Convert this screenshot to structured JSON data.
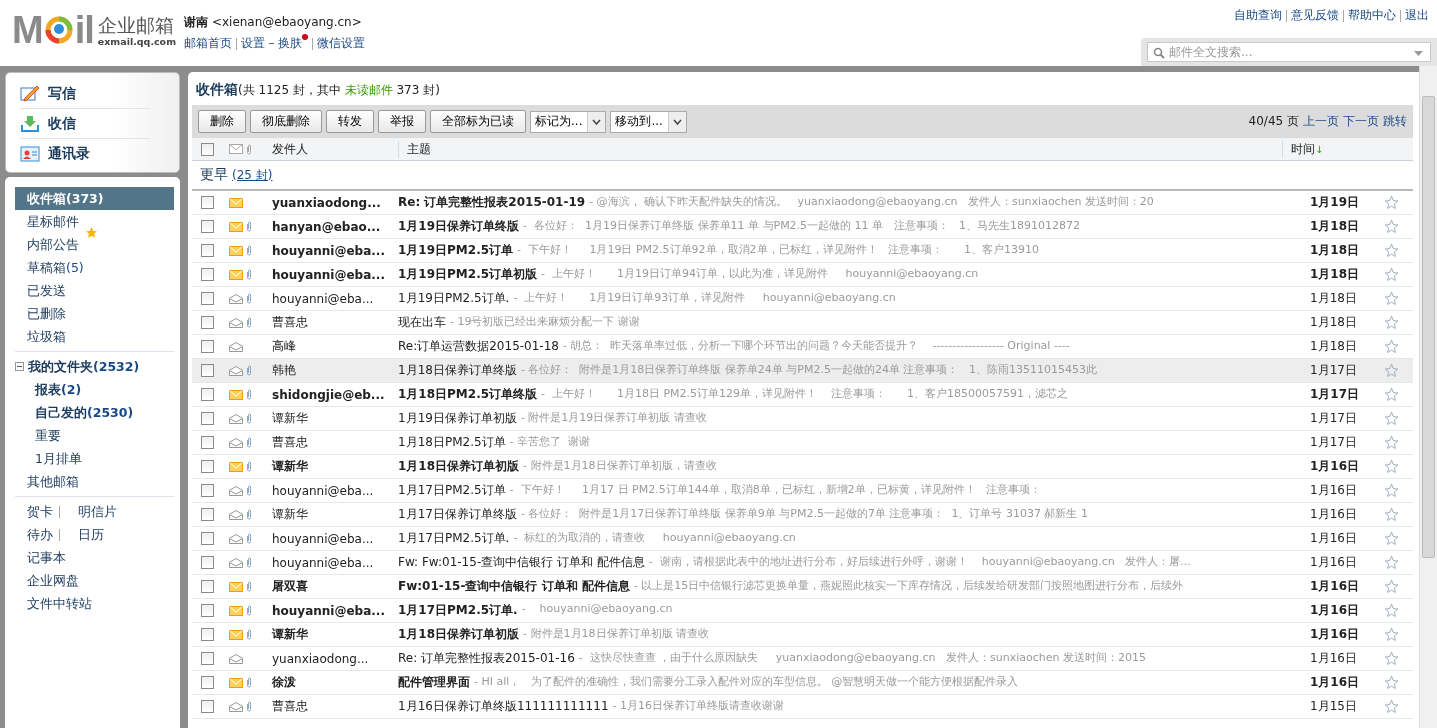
{
  "logo": {
    "prefix": "M",
    "suffix": "il",
    "name": "企业邮箱",
    "domain": "exmail.qq.com"
  },
  "user": {
    "name": "谢南",
    "email": "<xienan@ebaoyang.cn>"
  },
  "nav_links": [
    {
      "label": "邮箱首页",
      "badge": false
    },
    {
      "label": "设置",
      "badge": false
    },
    {
      "label": "换肤",
      "badge": true
    },
    {
      "label": "微信设置",
      "badge": false
    }
  ],
  "top_links": [
    "自助查询",
    "意见反馈",
    "帮助中心",
    "退出"
  ],
  "search": {
    "placeholder": "邮件全文搜索..."
  },
  "actions": [
    {
      "label": "写信",
      "kind": "compose"
    },
    {
      "label": "收信",
      "kind": "receive"
    },
    {
      "label": "通讯录",
      "kind": "contacts"
    }
  ],
  "folders": [
    {
      "label": "收件箱",
      "count": "(373)",
      "selected": true,
      "starred": false
    },
    {
      "label": "星标邮件",
      "selected": false,
      "starred": true
    },
    {
      "label": "内部公告",
      "selected": false,
      "starred": false
    },
    {
      "label": "草稿箱",
      "count": "(5)",
      "selected": false,
      "starred": false
    },
    {
      "label": "已发送",
      "selected": false,
      "starred": false
    },
    {
      "label": "已删除",
      "selected": false,
      "starred": false
    },
    {
      "label": "垃圾箱",
      "selected": false,
      "starred": false
    }
  ],
  "my_folders": {
    "label": "我的文件夹",
    "count": "(2532)",
    "expanded": true,
    "children": [
      {
        "label": "报表",
        "count": "(2)",
        "bold": true
      },
      {
        "label": "自己发的",
        "count": "(2530)",
        "bold": true
      },
      {
        "label": "重要",
        "bold": false
      },
      {
        "label": "1月排单",
        "bold": false
      }
    ]
  },
  "other_mail": "其他邮箱",
  "tools": [
    [
      "贺卡",
      "明信片"
    ],
    [
      "待办",
      "日历"
    ],
    [
      "记事本"
    ],
    [
      "企业网盘"
    ],
    [
      "文件中转站"
    ]
  ],
  "inbox": {
    "title": "收件箱",
    "summary_prefix": "(共 1125 封，其中 ",
    "unread_label": "未读邮件",
    "summary_suffix": " 373 封)"
  },
  "toolbar": {
    "buttons": [
      "删除",
      "彻底删除",
      "转发",
      "举报",
      "全部标为已读"
    ],
    "dropdowns": [
      "标记为...",
      "移动到..."
    ],
    "page": "40/45 页",
    "page_links": [
      "上一页",
      "下一页",
      "跳转"
    ]
  },
  "columns": {
    "select_all_checked": false,
    "sender": "发件人",
    "subject": "主题",
    "time": "时间",
    "sort_arrow": "↓"
  },
  "group": {
    "label": "更早",
    "count": "(25 封)"
  },
  "emails": [
    {
      "sender": "yuanxiaodong...",
      "subject": "Re: 订单完整性报表2015-01-19",
      "preview": "- @海滨， 确认下昨天配件缺失的情况。   yuanxiaodong@ebaoyang.cn   发件人：sunxiaochen 发送时间：20",
      "date": "1月19日",
      "unread": true,
      "attachment": false,
      "selected": false,
      "checked": false
    },
    {
      "sender": "hanyan@ebao...",
      "subject": "1月19日保养订单终版",
      "preview": "-  各位好：  1月19日保养订单终版 保养单11 单 与PM2.5一起做的 11 单   注意事项：   1、马先生1891012872",
      "date": "1月18日",
      "unread": true,
      "attachment": true,
      "selected": false,
      "checked": false
    },
    {
      "sender": "houyanni@eba...",
      "subject": "1月19日PM2.5订单",
      "preview": "-  下午好！     1月19日 PM2.5订单92单，取消2单，已标红，详见附件！   注意事项：      1、客户13910",
      "date": "1月18日",
      "unread": true,
      "attachment": true,
      "selected": false,
      "checked": false
    },
    {
      "sender": "houyanni@eba...",
      "subject": "1月19日PM2.5订单初版",
      "preview": "-  上午好！      1月19日订单94订单，以此为准，详见附件     houyanni@ebaoyang.cn",
      "date": "1月18日",
      "unread": true,
      "attachment": true,
      "selected": false,
      "checked": false
    },
    {
      "sender": "houyanni@eba...",
      "subject": "1月19日PM2.5订单.",
      "preview": "-  上午好！      1月19日订单93订单，详见附件     houyanni@ebaoyang.cn",
      "date": "1月18日",
      "unread": false,
      "attachment": true,
      "selected": false,
      "checked": false
    },
    {
      "sender": "曹喜忠",
      "subject": "现在出车",
      "preview": "- 19号初版已经出来麻烦分配一下 谢谢",
      "date": "1月18日",
      "unread": false,
      "attachment": true,
      "selected": false,
      "checked": false
    },
    {
      "sender": "高峰",
      "subject": "Re:订单运营数据2015-01-18",
      "preview": "- 胡总：  昨天落单率过低，分析一下哪个环节出的问题？今天能否提升？    ------------------ Original ----",
      "date": "1月18日",
      "unread": false,
      "attachment": false,
      "selected": false,
      "checked": false
    },
    {
      "sender": "韩艳",
      "subject": "1月18日保养订单终版",
      "preview": "- 各位好：  附件是1月18日保养订单终版 保养单24单 与PM2.5一起做的24单 注意事项：   1、陈雨13511015453此",
      "date": "1月17日",
      "unread": false,
      "attachment": true,
      "selected": true,
      "checked": false
    },
    {
      "sender": "shidongjie@eb...",
      "subject": "1月18日PM2.5订单终版",
      "preview": "-  上午好！      1月18日 PM2.5订单129单，详见附件！    注意事项：      1、客户18500057591，滤芯之",
      "date": "1月17日",
      "unread": true,
      "attachment": true,
      "selected": false,
      "checked": false
    },
    {
      "sender": "谭新华",
      "subject": "1月19日保养订单初版",
      "preview": "- 附件是1月19日保养订单初版 请查收",
      "date": "1月17日",
      "unread": false,
      "attachment": true,
      "selected": false,
      "checked": false
    },
    {
      "sender": "曹喜忠",
      "subject": "1月18日PM2.5订单",
      "preview": "- 辛苦您了  谢谢",
      "date": "1月17日",
      "unread": false,
      "attachment": true,
      "selected": false,
      "checked": false
    },
    {
      "sender": "谭新华",
      "subject": "1月18日保养订单初版",
      "preview": "- 附件是1月18日保养订单初版，请查收",
      "date": "1月16日",
      "unread": true,
      "attachment": true,
      "selected": false,
      "checked": false
    },
    {
      "sender": "houyanni@eba...",
      "subject": "1月17日PM2.5订单",
      "preview": "-  下午好！     1月17 日 PM2.5订单144单，取消8单，已标红，新增2单，已标黄，详见附件！   注意事项：",
      "date": "1月16日",
      "unread": false,
      "attachment": true,
      "selected": false,
      "checked": false
    },
    {
      "sender": "谭新华",
      "subject": "1月17日保养订单终版",
      "preview": "- 各位好：  附件是1月17日保养订单终版 保养单9单 与PM2.5一起做的7单 注意事项：  1、订单号 31037 郝新生 1",
      "date": "1月16日",
      "unread": false,
      "attachment": true,
      "selected": false,
      "checked": false
    },
    {
      "sender": "houyanni@eba...",
      "subject": "1月17日PM2.5订单.",
      "preview": "-  标红的为取消的，请查收     houyanni@ebaoyang.cn",
      "date": "1月16日",
      "unread": false,
      "attachment": true,
      "selected": false,
      "checked": false
    },
    {
      "sender": "houyanni@eba...",
      "subject": "Fw: Fw:01-15-查询中信银行  订单和 配件信息",
      "preview": "-  谢南，请根据此表中的地址进行分布，好后续进行外呼，谢谢！    houyanni@ebaoyang.cn   发件人：屠...",
      "date": "1月16日",
      "unread": false,
      "attachment": true,
      "selected": false,
      "checked": false
    },
    {
      "sender": "屠双喜",
      "subject": "Fw:01-15-查询中信银行  订单和 配件信息",
      "preview": "- 以上是15日中信银行滤芯更换单量，燕妮照此核实一下库存情况，后续发给研发部门按照地图进行分布，后续外",
      "date": "1月16日",
      "unread": true,
      "attachment": true,
      "selected": false,
      "checked": false
    },
    {
      "sender": "houyanni@eba...",
      "subject": "1月17日PM2.5订单.",
      "preview": "-    houyanni@ebaoyang.cn",
      "date": "1月16日",
      "unread": true,
      "attachment": true,
      "selected": false,
      "checked": false
    },
    {
      "sender": "谭新华",
      "subject": "1月18日保养订单初版",
      "preview": "- 附件是1月18日保养订单初版 请查收",
      "date": "1月16日",
      "unread": true,
      "attachment": true,
      "selected": false,
      "checked": false
    },
    {
      "sender": "yuanxiaodong...",
      "subject": "Re: 订单完整性报表2015-01-16",
      "preview": "-  这快尽快查查 ，由于什么原因缺失     yuanxiaodong@ebaoyang.cn   发件人：sunxiaochen 发送时间：2015",
      "date": "1月16日",
      "unread": false,
      "attachment": false,
      "selected": false,
      "checked": false
    },
    {
      "sender": "徐泼",
      "subject": "配件管理界面",
      "preview": "- HI all，   为了配件的准确性，我们需要分工录入配件对应的车型信息。 @智慧明天做一个能方便根据配件录入",
      "date": "1月16日",
      "unread": true,
      "attachment": true,
      "selected": false,
      "checked": false
    },
    {
      "sender": "曹喜忠",
      "subject": "1月16日保养订单终版111111111111",
      "preview": "- 1月16日保养订单终版请查收谢谢",
      "date": "1月15日",
      "unread": false,
      "attachment": true,
      "selected": false,
      "checked": false
    }
  ]
}
